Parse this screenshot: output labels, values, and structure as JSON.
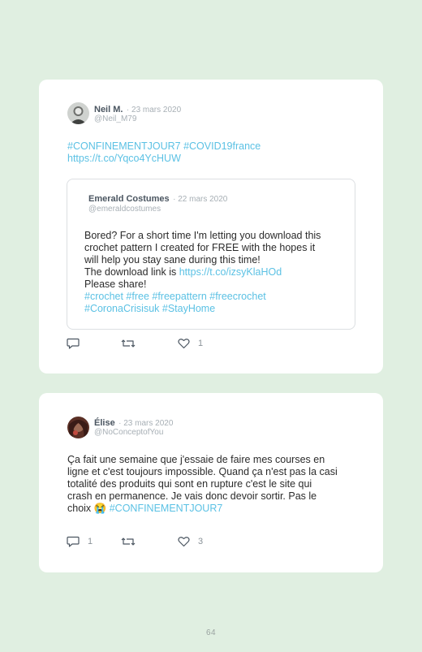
{
  "tweets": [
    {
      "author": "Neil M.",
      "date": "· 23 mars 2020",
      "handle": "@Neil_M79",
      "lines": [
        "#CONFINEMENTJOUR7 #COVID19france",
        "https://t.co/Yqco4YcHUW"
      ],
      "quoted": {
        "author": "Emerald Costumes",
        "date": "· 22 mars 2020",
        "handle": "@emeraldcostumes",
        "text_lines": [
          "Bored? For a short time I'm letting you download this",
          "crochet pattern I created for FREE with the hopes it",
          "will help you stay sane during this time!",
          "The download link is "
        ],
        "download_link": "https://t.co/izsyKlaHOd",
        "share_line": "Please share!",
        "hashtag_lines": [
          "#crochet #free #freepattern #freecrochet",
          "#CoronaCrisisuk #StayHome"
        ]
      },
      "replies": "",
      "likes": "1"
    },
    {
      "author": "Élise",
      "date": "· 23 mars 2020",
      "handle": "@NoConceptofYou",
      "text_lines": [
        "Ça fait une semaine que j'essaie de faire mes courses en",
        "ligne et c'est toujours impossible. Quand ça n'est pas la casi",
        "totalité des produits qui sont en rupture c'est le site qui",
        "crash en permanence. Je vais donc devoir sortir. Pas le",
        "choix "
      ],
      "emoji": "😭",
      "hashtag": "#CONFINEMENTJOUR7",
      "replies": "1",
      "likes": "3"
    }
  ],
  "icons": [
    "reply-icon",
    "retweet-icon",
    "heart-icon"
  ],
  "colors": {
    "background": "#e0efe1",
    "link": "#5bc1e4",
    "card": "#ffffff"
  },
  "page_number": "64"
}
